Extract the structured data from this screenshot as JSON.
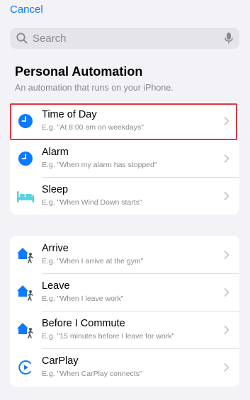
{
  "nav": {
    "cancel_label": "Cancel"
  },
  "search": {
    "placeholder": "Search"
  },
  "section": {
    "title": "Personal Automation",
    "subtitle": "An automation that runs on your iPhone."
  },
  "group1": [
    {
      "title": "Time of Day",
      "subtitle": "E.g. \"At 8:00 am on weekdays\"",
      "icon": "clock-icon"
    },
    {
      "title": "Alarm",
      "subtitle": "E.g. \"When my alarm has stopped\"",
      "icon": "clock-icon"
    },
    {
      "title": "Sleep",
      "subtitle": "E.g. \"When Wind Down starts\"",
      "icon": "bed-icon"
    }
  ],
  "group2": [
    {
      "title": "Arrive",
      "subtitle": "E.g. \"When I arrive at the gym\"",
      "icon": "arrive-icon"
    },
    {
      "title": "Leave",
      "subtitle": "E.g. \"When I leave work\"",
      "icon": "leave-icon"
    },
    {
      "title": "Before I Commute",
      "subtitle": "E.g. \"15 minutes before I leave for work\"",
      "icon": "commute-icon"
    },
    {
      "title": "CarPlay",
      "subtitle": "E.g. \"When CarPlay connects\"",
      "icon": "carplay-icon"
    }
  ],
  "colors": {
    "accent": "#0a7aff",
    "highlight": "#e4343f",
    "sleep": "#5ad3e0"
  }
}
